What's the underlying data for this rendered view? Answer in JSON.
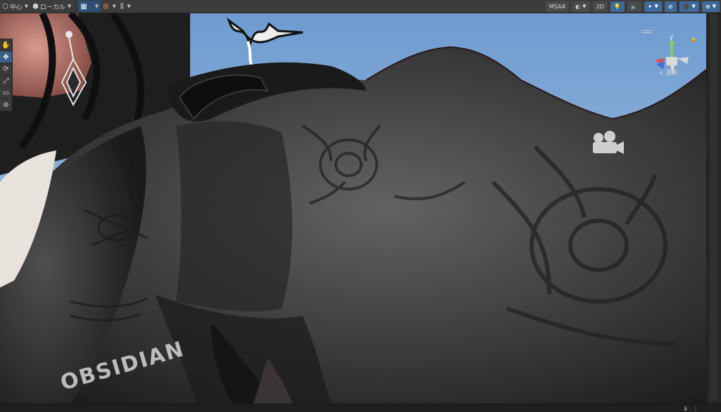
{
  "toolbar": {
    "pivot_label": "中心",
    "space_label": "ローカル",
    "grid_glyph": "▦",
    "snap_glyph": "⊞",
    "increment_glyph": "⫼",
    "msaa_label": "MSAA",
    "mode_2d_label": "2D",
    "shading_glyph": "◐",
    "lighting_glyph": "💡",
    "audio_glyph": "🔈",
    "effects_glyph": "✦",
    "hidden_glyph": "⊘",
    "camera_glyph": "🎥",
    "gizmos_glyph": "⊕",
    "accent_color": "#3d6a98"
  },
  "tools": [
    {
      "name": "hand-tool",
      "glyph": "✋"
    },
    {
      "name": "move-tool",
      "glyph": "✥"
    },
    {
      "name": "rotate-tool",
      "glyph": "⟳"
    },
    {
      "name": "scale-tool",
      "glyph": "⤢"
    },
    {
      "name": "rect-tool",
      "glyph": "▭"
    },
    {
      "name": "transform-tool",
      "glyph": "⊛"
    }
  ],
  "gizmo": {
    "y_label": "y",
    "persp_label": "< 透視"
  },
  "scene": {
    "garment_text": "OBSIDIAN"
  },
  "status": {
    "icon_a": "ā",
    "icon_b": "⋮"
  }
}
